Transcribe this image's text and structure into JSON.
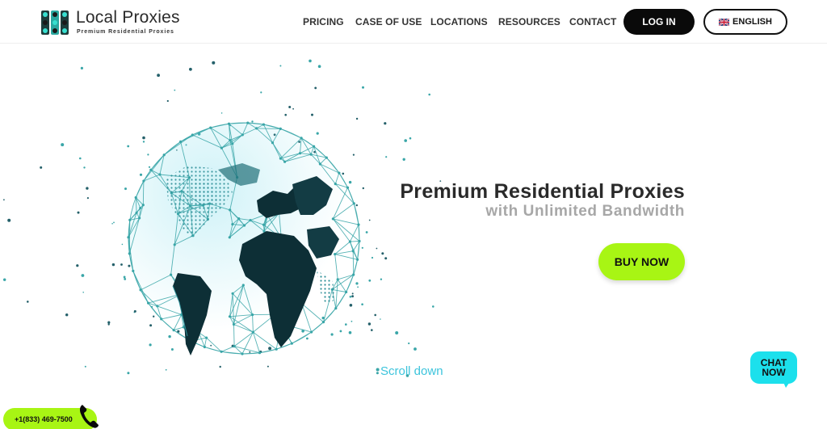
{
  "header": {
    "logo": {
      "name": "Local Proxies",
      "tagline": "Premium Residential Proxies",
      "icon": "dot-grid-logo-icon"
    },
    "nav": [
      {
        "label": "PRICING"
      },
      {
        "label": "CASE OF USE"
      },
      {
        "label": "LOCATIONS"
      },
      {
        "label": "RESOURCES"
      },
      {
        "label": "CONTACT"
      }
    ],
    "login_label": "LOG IN",
    "language_label": "ENGLISH",
    "language_icon": "uk-flag-icon"
  },
  "hero": {
    "title": "Premium Residential Proxies",
    "subtitle": "with Unlimited Bandwidth",
    "buy_label": "BUY NOW",
    "scroll_label": "Scroll down",
    "image": "wireframe-globe-icon"
  },
  "chat": {
    "line1": "CHAT",
    "line2": "NOW",
    "icon": "chat-bubble-icon"
  },
  "phone": {
    "number": "+1(833) 469-7500",
    "icon": "phone-handset-icon"
  },
  "colors": {
    "accent_green": "#a8f514",
    "accent_cyan": "#1ce0ec",
    "globe_teal": "#3aa6a8",
    "dark": "#0a0a0a"
  }
}
